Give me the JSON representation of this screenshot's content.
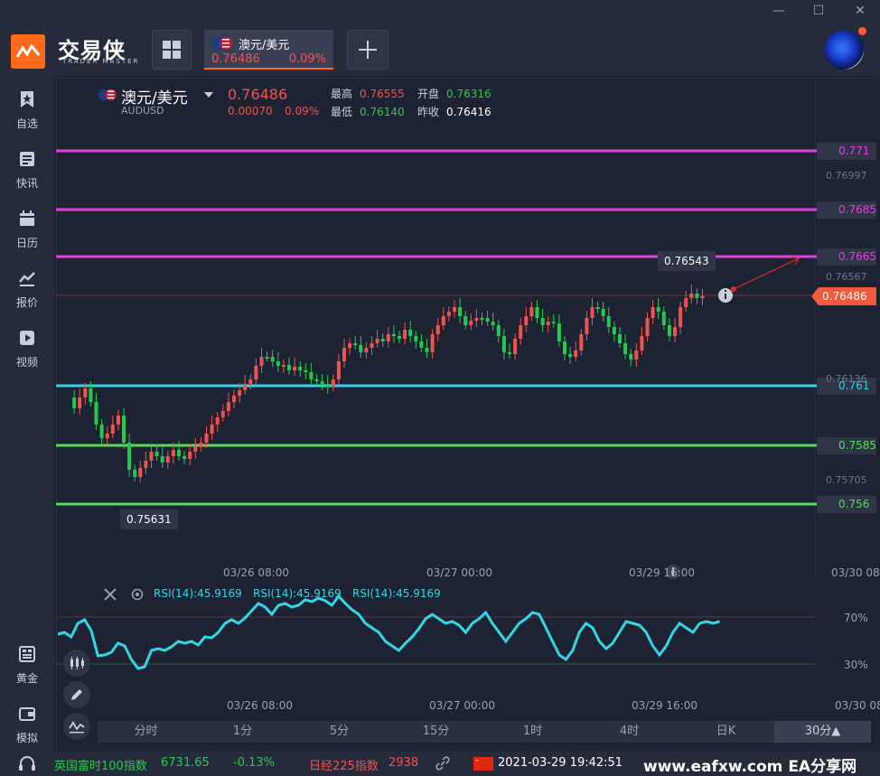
{
  "window": {
    "minimize": "—",
    "maximize": "☐",
    "close": "✕"
  },
  "app": {
    "name": "交易侠",
    "subtitle": "TRADER MASTER"
  },
  "tab": {
    "name": "澳元/美元",
    "price": "0.76486",
    "pct": "0.09%"
  },
  "sidebar": {
    "items": [
      {
        "label": "自选",
        "icon": "star-bookmark-icon"
      },
      {
        "label": "快讯",
        "icon": "news-icon"
      },
      {
        "label": "日历",
        "icon": "calendar-icon"
      },
      {
        "label": "报价",
        "icon": "chart-line-icon"
      },
      {
        "label": "视频",
        "icon": "video-icon"
      }
    ],
    "bottom_items": [
      {
        "label": "黄金",
        "icon": "gold-icon"
      },
      {
        "label": "模拟",
        "icon": "wallet-icon"
      }
    ]
  },
  "symbol": {
    "name": "澳元/美元",
    "code": "AUDUSD",
    "price": "0.76486",
    "change": "0.00070",
    "change_pct": "0.09%",
    "high_label": "最高",
    "high": "0.76555",
    "open_label": "开盘",
    "open": "0.76316",
    "low_label": "最低",
    "low": "0.76140",
    "prev_label": "昨收",
    "prev": "0.76416"
  },
  "price_axis": {
    "levels": [
      {
        "value": "0.771",
        "color": "#e040e0"
      },
      {
        "value": "0.7685",
        "color": "#e040e0"
      },
      {
        "value": "0.7665",
        "color": "#e040e0"
      },
      {
        "value": "0.761",
        "color": "#33d6e6"
      },
      {
        "value": "0.7585",
        "color": "#55dd55"
      },
      {
        "value": "0.756",
        "color": "#55dd55"
      }
    ],
    "ticks": [
      "0.76997",
      "0.76567",
      "0.76136",
      "0.75705"
    ],
    "current": "0.76486",
    "high_callout": "0.76543",
    "low_callout": "0.75631"
  },
  "time_axis": {
    "labels": [
      "03/26 08:00",
      "03/27 00:00",
      "03/29 16:00",
      "03/30 08"
    ]
  },
  "rsi": {
    "labels": [
      "RSI(14):45.9169",
      "RSI(14):45.9169",
      "RSI(14):45.9169"
    ],
    "levels": [
      "70%",
      "30%"
    ]
  },
  "timeframes": [
    "分时",
    "1分",
    "5分",
    "15分",
    "1时",
    "4时",
    "日K",
    "30分▲"
  ],
  "status": {
    "index1_name": "英国富时100指数",
    "index1_value": "6731.65",
    "index1_change": "-0.13%",
    "index2_name": "日经225指数",
    "index2_value": "2938",
    "datetime": "2021-03-29 19:42:51",
    "watermark": "www.eafxw.com  EA分享网"
  },
  "colors": {
    "up": "#ef5350",
    "down": "#26c94f",
    "accent": "#ff6a1a",
    "rsi": "#33d6e6"
  }
}
